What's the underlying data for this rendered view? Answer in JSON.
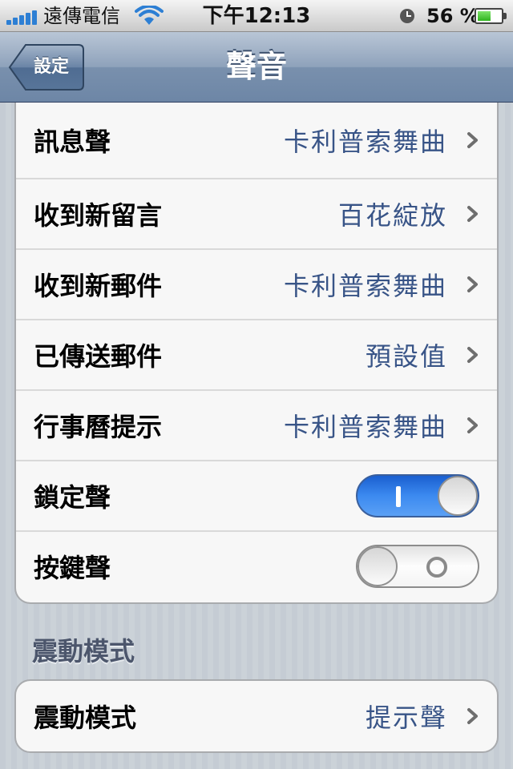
{
  "status_bar": {
    "carrier": "遠傳電信",
    "time": "下午12:13",
    "battery_percent": "56 %",
    "battery_level": 0.56,
    "signal_bars": 5,
    "wifi_icon": "wifi-icon",
    "alarm_icon": "clock-icon"
  },
  "nav": {
    "back_label": "設定",
    "title": "聲音"
  },
  "settings_group": [
    {
      "label": "訊息聲",
      "value": "卡利普索舞曲"
    },
    {
      "label": "收到新留言",
      "value": "百花綻放"
    },
    {
      "label": "收到新郵件",
      "value": "卡利普索舞曲"
    },
    {
      "label": "已傳送郵件",
      "value": "預設值"
    },
    {
      "label": "行事曆提示",
      "value": "卡利普索舞曲"
    }
  ],
  "toggles": [
    {
      "label": "鎖定聲",
      "on": true
    },
    {
      "label": "按鍵聲",
      "on": false
    }
  ],
  "vibration_section": {
    "header": "震動模式",
    "row_label": "震動模式",
    "row_value": "提示聲"
  },
  "colors": {
    "value_text": "#385487",
    "switch_on": "#3c8af0",
    "navbar": "#6d86a6"
  }
}
